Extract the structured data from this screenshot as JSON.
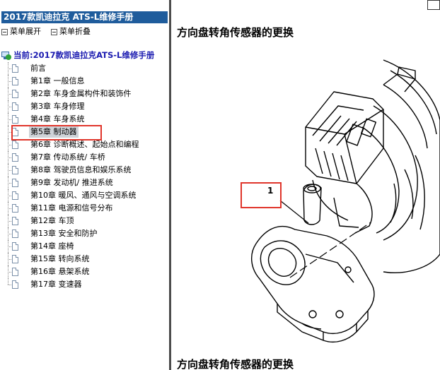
{
  "sidebar": {
    "title": "2017款凯迪拉克 ATS-L维修手册",
    "controls": {
      "expand_label": "菜单展开",
      "collapse_label": "菜单折叠"
    },
    "root_label": "当前:2017款凯迪拉克ATS-L维修手册",
    "items": [
      {
        "label": "前言"
      },
      {
        "label": "第1章  一般信息"
      },
      {
        "label": "第2章  车身金属构件和装饰件"
      },
      {
        "label": "第3章  车身修理"
      },
      {
        "label": "第4章  车身系统"
      },
      {
        "label": "第5章  制动器"
      },
      {
        "label": "第6章  诊断概述、起始点和编程"
      },
      {
        "label": "第7章  传动系统/ 车桥"
      },
      {
        "label": "第8章  驾驶员信息和娱乐系统"
      },
      {
        "label": "第9章  发动机/ 推进系统"
      },
      {
        "label": "第10章  暖风、通风与空调系统"
      },
      {
        "label": "第11章  电源和信号分布"
      },
      {
        "label": "第12章  车顶"
      },
      {
        "label": "第13章  安全和防护"
      },
      {
        "label": "第14章  座椅"
      },
      {
        "label": "第15章  转向系统"
      },
      {
        "label": "第16章  悬架系统"
      },
      {
        "label": "第17章  变速器"
      }
    ],
    "selected_index": 5
  },
  "content": {
    "heading": "方向盘转角传感器的更换",
    "heading_repeat": "方向盘转角传感器的更换",
    "callout_number": "1"
  },
  "colors": {
    "title_bar": "#1f5c9c",
    "root_text": "#1a1ab0",
    "highlight": "#e0352b",
    "selected_bg": "#cfd3d8"
  },
  "icons": {
    "menu_control": "minus-box-icon",
    "root": "monitor-check-icon",
    "item": "document-icon"
  }
}
